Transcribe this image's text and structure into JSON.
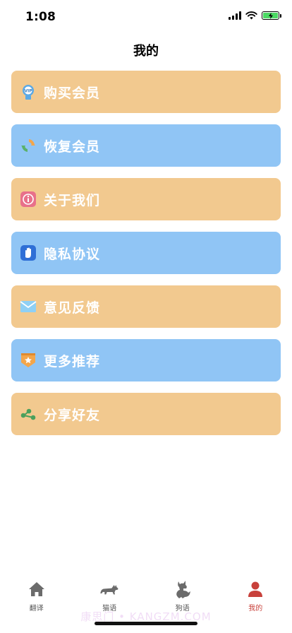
{
  "status": {
    "time": "1:08"
  },
  "nav": {
    "title": "我的"
  },
  "menu": [
    {
      "label": "购买会员",
      "style": "orange",
      "icon": "vip-badge-icon"
    },
    {
      "label": "恢复会员",
      "style": "blue",
      "icon": "restore-icon"
    },
    {
      "label": "关于我们",
      "style": "orange",
      "icon": "info-icon"
    },
    {
      "label": "隐私协议",
      "style": "blue",
      "icon": "hand-icon"
    },
    {
      "label": "意见反馈",
      "style": "orange",
      "icon": "mail-icon"
    },
    {
      "label": "更多推荐",
      "style": "blue",
      "icon": "star-shield-icon"
    },
    {
      "label": "分享好友",
      "style": "orange",
      "icon": "share-icon"
    }
  ],
  "tabs": [
    {
      "label": "翻译",
      "icon": "home-icon"
    },
    {
      "label": "猫语",
      "icon": "cat-icon"
    },
    {
      "label": "狗语",
      "icon": "dog-icon"
    },
    {
      "label": "我的",
      "icon": "profile-icon",
      "active": true
    }
  ],
  "watermark": "康思门 • KANGZM.COM",
  "colors": {
    "orange": "#f2c98f",
    "blue": "#90c5f5",
    "active_tab": "#c8413b"
  }
}
